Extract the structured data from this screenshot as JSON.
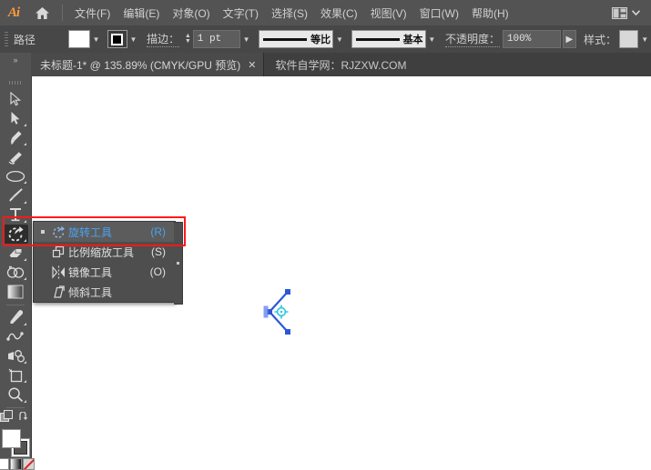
{
  "app": {
    "name": "Ai",
    "logo_icon": "illustrator-logo-icon",
    "home_icon": "home-icon",
    "workspace_icon": "workspace-switcher-icon",
    "workspace_caret": "chevron-down-icon"
  },
  "menubar": {
    "items": [
      {
        "label": "文件(F)",
        "name": "menu-file"
      },
      {
        "label": "编辑(E)",
        "name": "menu-edit"
      },
      {
        "label": "对象(O)",
        "name": "menu-object"
      },
      {
        "label": "文字(T)",
        "name": "menu-type"
      },
      {
        "label": "选择(S)",
        "name": "menu-select"
      },
      {
        "label": "效果(C)",
        "name": "menu-effect"
      },
      {
        "label": "视图(V)",
        "name": "menu-view"
      },
      {
        "label": "窗口(W)",
        "name": "menu-window"
      },
      {
        "label": "帮助(H)",
        "name": "menu-help"
      }
    ]
  },
  "controlbar": {
    "selection_label": "路径",
    "fill_swatch_color": "#ffffff",
    "stroke_swatch_label": "stroke-swatch",
    "stroke_weight_label": "描边：",
    "stroke_weight_value": "1 pt",
    "variable_width_profile": "等比",
    "brush_definition": "基本",
    "opacity_label": "不透明度：",
    "opacity_value": "100%",
    "style_label": "样式：",
    "style_swatch_color": "#d8d8d8"
  },
  "tabbar": {
    "collapse_icon": "double-chevron-right-icon",
    "document_title": "未标题-1* @ 135.89% (CMYK/GPU 预览)",
    "close_label": "✕",
    "note": "软件自学网：RJZXW.COM"
  },
  "toolbar": {
    "tools": [
      {
        "name": "selection-tool",
        "icon": "selection-arrow-icon",
        "has_more": false
      },
      {
        "name": "direct-selection-tool",
        "icon": "direct-selection-arrow-icon",
        "has_more": true
      },
      {
        "name": "pen-tool",
        "icon": "pen-icon",
        "has_more": true
      },
      {
        "name": "curvature-tool",
        "icon": "curvature-icon",
        "has_more": false
      },
      {
        "name": "ellipse-tool",
        "icon": "ellipse-icon",
        "has_more": true
      },
      {
        "name": "paintbrush-tool",
        "icon": "paintbrush-icon",
        "has_more": true
      },
      {
        "name": "type-tool",
        "icon": "type-t-icon",
        "has_more": true
      },
      {
        "name": "rotate-tool",
        "icon": "rotate-icon",
        "has_more": true,
        "selected": true
      },
      {
        "name": "eraser-tool",
        "icon": "eraser-icon",
        "has_more": true
      },
      {
        "name": "shape-builder-tool",
        "icon": "shape-builder-icon",
        "has_more": true
      },
      {
        "name": "gradient-tool",
        "icon": "gradient-icon",
        "has_more": false
      },
      {
        "name": "eyedropper-tool",
        "icon": "eyedropper-icon",
        "has_more": true
      },
      {
        "name": "blend-tool",
        "icon": "blend-icon",
        "has_more": false
      },
      {
        "name": "symbol-sprayer-tool",
        "icon": "symbol-sprayer-icon",
        "has_more": true
      },
      {
        "name": "artboard-tool",
        "icon": "artboard-icon",
        "has_more": true
      },
      {
        "name": "zoom-tool",
        "icon": "magnifier-icon",
        "has_more": true
      }
    ],
    "edit_toolbar_icon": "edit-toolbar-icon",
    "swap_icon": "swap-fill-stroke-icon",
    "fill_color": "#ffffff",
    "stroke_color": "#ffffff",
    "color_modes": [
      {
        "name": "color-mode-white",
        "icon": "solid-color-icon"
      },
      {
        "name": "color-mode-gradient",
        "icon": "gradient-swatch-icon"
      },
      {
        "name": "color-mode-none",
        "icon": "none-swatch-icon"
      }
    ]
  },
  "flyout": {
    "items": [
      {
        "label": "旋转工具",
        "shortcut": "(R)",
        "icon": "rotate-icon",
        "name": "flyout-rotate-tool",
        "active": true
      },
      {
        "label": "比例缩放工具",
        "shortcut": "(S)",
        "icon": "scale-icon",
        "name": "flyout-scale-tool",
        "active": false
      },
      {
        "label": "镜像工具",
        "shortcut": "(O)",
        "icon": "reflect-icon",
        "name": "flyout-reflect-tool",
        "active": false
      },
      {
        "label": "倾斜工具",
        "shortcut": "",
        "icon": "shear-icon",
        "name": "flyout-shear-tool",
        "active": false
      }
    ],
    "tearoff_icon": "tearoff-handle-icon"
  },
  "highlight": {
    "color": "#ff1a1a",
    "name": "red-annotation-box"
  },
  "artwork": {
    "path_name": "selected-path",
    "stroke_color": "#2e56d8",
    "anchor_color": "#2e56d8",
    "origin_icon": "rotation-origin-icon",
    "origin_color": "#27c6e0"
  }
}
